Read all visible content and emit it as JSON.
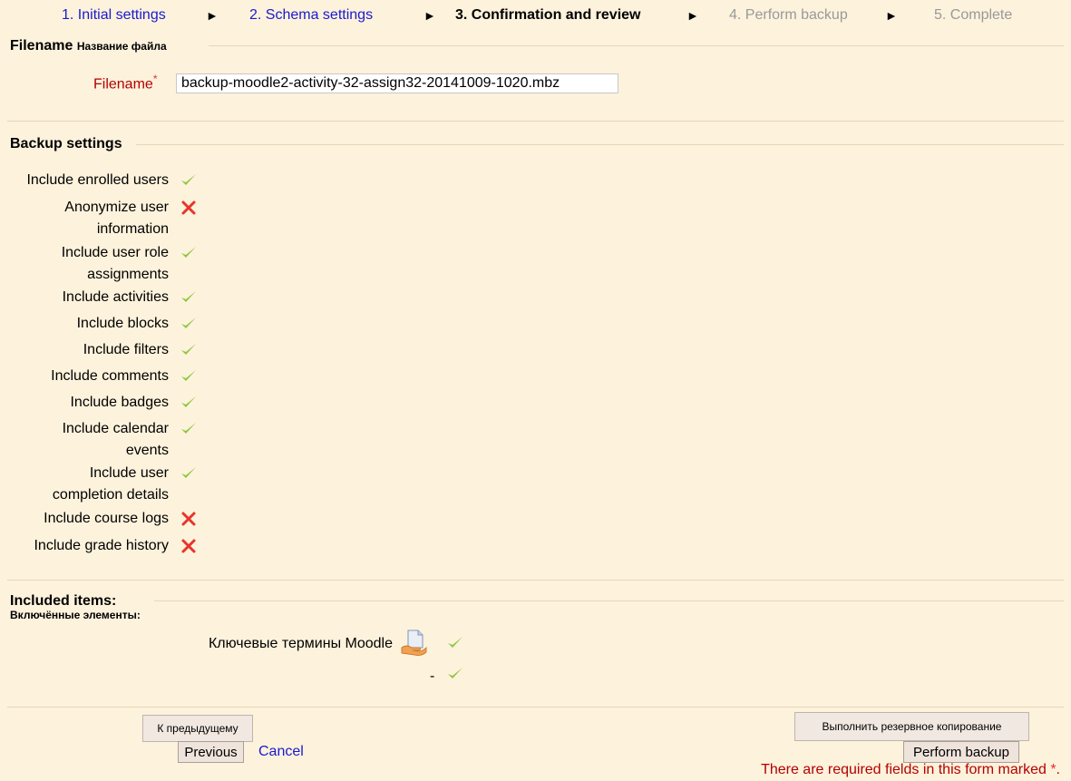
{
  "progress": {
    "steps": [
      {
        "label": "1. Initial settings",
        "state": "link"
      },
      {
        "label": "2. Schema settings",
        "state": "link"
      },
      {
        "label": "3. Confirmation and review",
        "state": "current"
      },
      {
        "label": "4. Perform backup",
        "state": "future"
      },
      {
        "label": "5. Complete",
        "state": "future"
      }
    ],
    "separator": "►"
  },
  "filename_section": {
    "legend": "Filename",
    "legend_sub": "Название файла",
    "label": "Filename",
    "required_mark": "*",
    "value": "backup-moodle2-activity-32-assign32-20141009-1020.mbz"
  },
  "backup_settings": {
    "legend": "Backup settings",
    "items": [
      {
        "line1": "Include enrolled users",
        "line2": "",
        "status": "yes"
      },
      {
        "line1": "Anonymize user",
        "line2": "information",
        "status": "no"
      },
      {
        "line1": "Include user role",
        "line2": "assignments",
        "status": "yes"
      },
      {
        "line1": "Include activities",
        "line2": "",
        "status": "yes"
      },
      {
        "line1": "Include blocks",
        "line2": "",
        "status": "yes"
      },
      {
        "line1": "Include filters",
        "line2": "",
        "status": "yes"
      },
      {
        "line1": "Include comments",
        "line2": "",
        "status": "yes"
      },
      {
        "line1": "Include badges",
        "line2": "",
        "status": "yes"
      },
      {
        "line1": "Include calendar",
        "line2": "events",
        "status": "yes"
      },
      {
        "line1": "Include user",
        "line2": "completion details",
        "status": "yes"
      },
      {
        "line1": "Include course logs",
        "line2": "",
        "status": "no"
      },
      {
        "line1": "Include grade history",
        "line2": "",
        "status": "no"
      }
    ]
  },
  "included_items": {
    "legend": "Included items:",
    "legend_sub": "Включённые элементы:",
    "items": [
      {
        "label": "Ключевые термины Moodle",
        "status": "yes",
        "icon": "document-hand-icon"
      },
      {
        "label": "-",
        "status": "yes"
      }
    ]
  },
  "buttons": {
    "previous_ru": "К предыдущему",
    "previous": "Previous",
    "cancel": "Cancel",
    "perform_ru": "Выполнить резервное копирование",
    "perform": "Perform backup"
  },
  "required_note": {
    "text": "There are required fields in this form marked",
    "mark": "*",
    "end": "."
  },
  "colors": {
    "background": "#fdf2dc",
    "link": "#1a1acf",
    "check": "#8cc63f",
    "cross": "#e8342a",
    "required": "#b30000"
  }
}
